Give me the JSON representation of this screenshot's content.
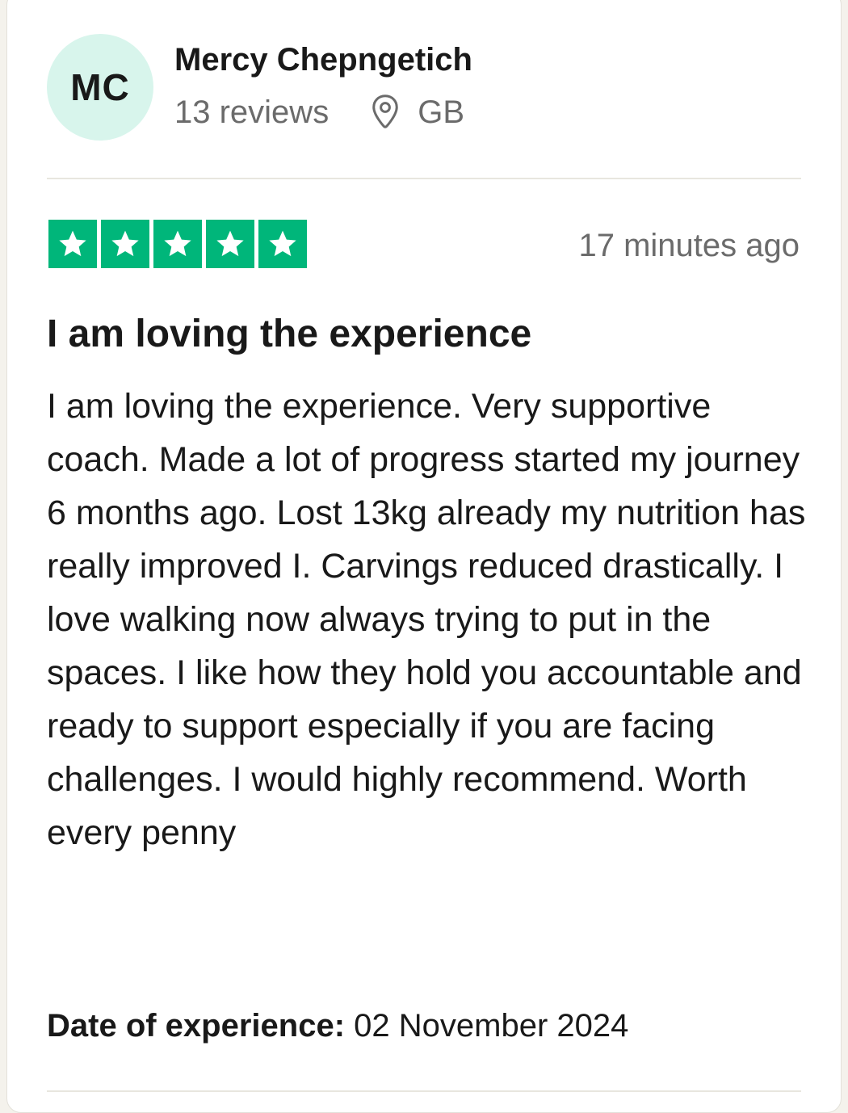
{
  "reviewer": {
    "initials": "MC",
    "name": "Mercy Chepngetich",
    "reviews": "13 reviews",
    "location": "GB"
  },
  "review": {
    "rating": 5,
    "rating_max": 5,
    "time_ago": "17 minutes ago",
    "title": "I am loving the experience",
    "body": "I am loving the experience. Very supportive coach. Made a lot of progress started my journey 6 months ago. Lost 13kg already my nutrition has really improved I. Carvings reduced drastically. I love walking now always trying to put in the spaces. I like how they hold you accountable and ready to support especially if you are facing challenges. I would highly recommend. Worth every penny",
    "date_label": "Date of experience:",
    "date_value": "02 November 2024"
  },
  "colors": {
    "star_green": "#00b67a",
    "avatar_bg": "#d8f5ec",
    "text": "#191919",
    "muted": "#6b6b6b"
  },
  "icons": [
    "location-pin-icon",
    "star-icon"
  ]
}
